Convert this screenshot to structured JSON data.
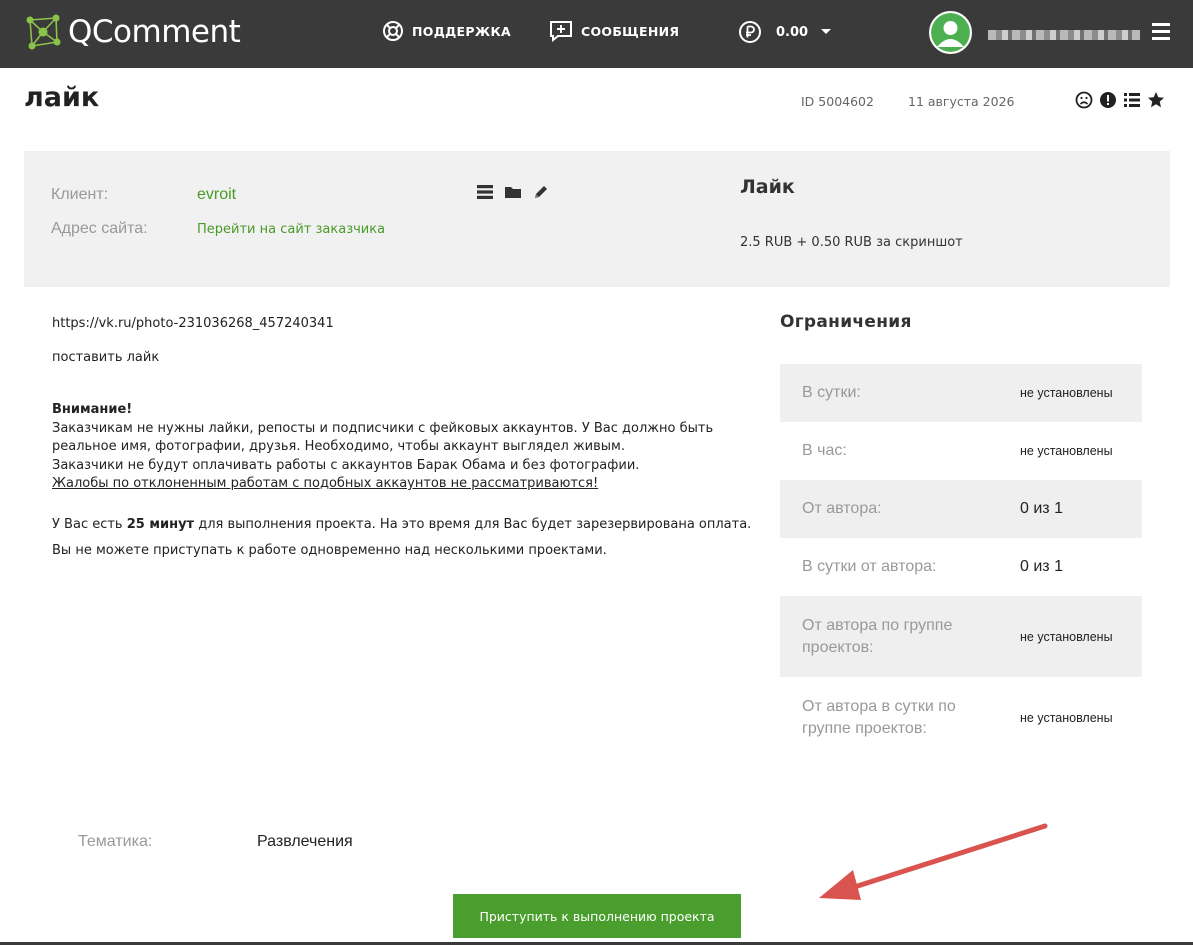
{
  "header": {
    "logo_text": "QComment",
    "nav": [
      {
        "label": "ПОДДЕРЖКА",
        "icon": "lifebuoy-icon"
      },
      {
        "label": "СООБЩЕНИЯ",
        "icon": "message-plus-icon"
      }
    ],
    "balance": {
      "value": "0.00",
      "icon": "ruble-icon"
    }
  },
  "task": {
    "title": "лайк",
    "id_label": "ID",
    "id": "5004602",
    "date": "11 августа 2026"
  },
  "client": {
    "client_label": "Клиент:",
    "client_name": "evroit",
    "site_label": "Адрес сайта:",
    "site_link": "Перейти на сайт заказчика",
    "task_name": "Лайк",
    "price": "2.5 RUB + 0.50 RUB за скриншот"
  },
  "content": {
    "url": "https://vk.ru/photo-231036268_457240341",
    "description": "поставить лайк",
    "warning_title": "Внимание!",
    "warning_line1": "Заказчикам не нужны лайки, репосты и подписчики с фейковых аккаунтов. У Вас должно быть реальное имя, фотографии, друзья. Необходимо, чтобы аккаунт выглядел живым.",
    "warning_line2": "Заказчики не будут оплачивать работы с аккаунтов Барак Обама и без фотографии.",
    "warning_link": "Жалобы по отклоненным работам с подобных аккаунтов не рассматриваются!",
    "time_pre": "У Вас есть",
    "time_bold": "25 минут",
    "time_post": "для выполнения проекта. На это время для Вас будет зарезервирована оплата.",
    "multi_note": "Вы не можете приступать к работе одновременно над несколькими проектами."
  },
  "limits": {
    "title": "Ограничения",
    "rows": [
      {
        "key": "В сутки:",
        "value": "не установлены"
      },
      {
        "key": "В час:",
        "value": "не установлены"
      },
      {
        "key": "От автора:",
        "value": "0 из 1"
      },
      {
        "key": "В сутки от автора:",
        "value": "0 из 1"
      },
      {
        "key": "От автора по группе проектов:",
        "value": "не установлены"
      },
      {
        "key": "От автора в сутки по группе проектов:",
        "value": "не установлены"
      }
    ]
  },
  "theme": {
    "label": "Тематика:",
    "value": "Развлечения"
  },
  "actions": {
    "start_label": "Приступить к выполнению проекта"
  },
  "colors": {
    "header_bg": "#3a3a3a",
    "accent_green": "#4a9e2d",
    "annotation_arrow": "#d9534f"
  }
}
